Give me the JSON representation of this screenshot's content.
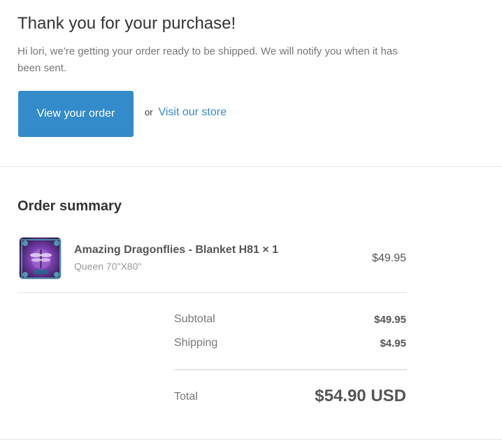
{
  "header": {
    "title": "Thank you for your purchase!",
    "message": "Hi lori, we're getting your order ready to be shipped. We will notify you when it has been sent.",
    "view_order_label": "View your order",
    "or_text": "or",
    "visit_store_label": "Visit our store"
  },
  "summary": {
    "title": "Order summary",
    "items": [
      {
        "title": "Amazing Dragonflies - Blanket H81 × 1",
        "variant": "Queen 70\"X80\"",
        "price": "$49.95",
        "thumbnail_icon": "dragonfly-blanket-image"
      }
    ],
    "subtotal_label": "Subtotal",
    "subtotal_value": "$49.95",
    "shipping_label": "Shipping",
    "shipping_value": "$4.95",
    "total_label": "Total",
    "total_value": "$54.90 USD"
  },
  "colors": {
    "accent": "#338bc9",
    "divider": "#e5e5e5"
  }
}
